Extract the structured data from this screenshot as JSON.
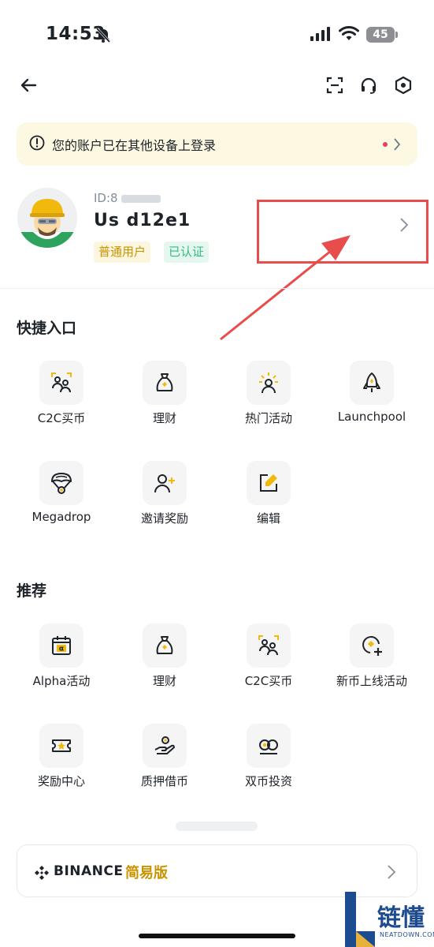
{
  "status_bar": {
    "time": "14:53",
    "battery": "45"
  },
  "notice": {
    "text": "您的账户已在其他设备上登录"
  },
  "profile": {
    "uid_prefix": "ID:8",
    "username": "Us d12e1",
    "badge_regular": "普通用户",
    "badge_verified": "已认证"
  },
  "quick_access": {
    "title": "快捷入口",
    "items": [
      {
        "label": "C2C买币",
        "icon": "c2c-people-icon"
      },
      {
        "label": "理财",
        "icon": "money-bag-icon"
      },
      {
        "label": "热门活动",
        "icon": "hot-activity-icon"
      },
      {
        "label": "Launchpool",
        "icon": "rocket-icon"
      },
      {
        "label": "Megadrop",
        "icon": "parachute-icon"
      },
      {
        "label": "邀请奖励",
        "icon": "add-user-icon"
      },
      {
        "label": "编辑",
        "icon": "edit-icon"
      }
    ]
  },
  "recommend": {
    "title": "推荐",
    "items": [
      {
        "label": "Alpha活动",
        "icon": "calendar-alpha-icon"
      },
      {
        "label": "理财",
        "icon": "money-bag-icon"
      },
      {
        "label": "C2C买币",
        "icon": "c2c-people-icon"
      },
      {
        "label": "新币上线活动",
        "icon": "new-coin-icon"
      },
      {
        "label": "奖励中心",
        "icon": "ticket-star-icon"
      },
      {
        "label": "质押借币",
        "icon": "hand-coin-icon"
      },
      {
        "label": "双币投资",
        "icon": "dual-coin-icon"
      }
    ]
  },
  "simple_mode": {
    "brand": "BINANCE",
    "label": "简易版"
  },
  "watermark": {
    "text": "链懂",
    "sub": "NEATDOWN.COM"
  },
  "colors": {
    "accent": "#F0B90B",
    "brand_text": "#C99400",
    "verified": "#2EBD85",
    "annotation": "#E84C4C"
  }
}
